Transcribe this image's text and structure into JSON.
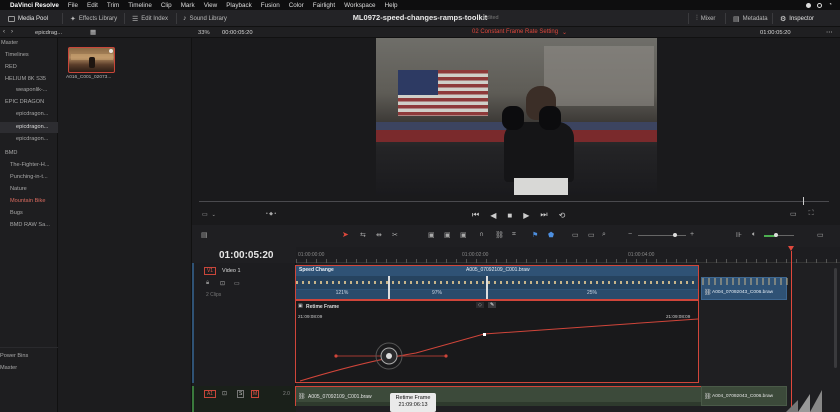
{
  "menubar": {
    "app_name": "DaVinci Resolve",
    "items": [
      "File",
      "Edit",
      "Trim",
      "Timeline",
      "Clip",
      "Mark",
      "View",
      "Playback",
      "Fusion",
      "Color",
      "Fairlight",
      "Workspace",
      "Help"
    ]
  },
  "toolbar": {
    "media_pool": "Media Pool",
    "effects_library": "Effects Library",
    "edit_index": "Edit Index",
    "sound_library": "Sound Library",
    "project_title": "ML0972-speed-changes-ramps-toolkit",
    "edited": "Edited",
    "mixer": "Mixer",
    "metadata": "Metadata",
    "inspector": "Inspector"
  },
  "subbar": {
    "bin_name": "epicdrag...",
    "zoom": "33%",
    "source_timecode": "00:00:05:20",
    "timeline_name": "02 Constant Frame Rate Setting",
    "record_timecode": "01:00:05:20"
  },
  "bins": [
    {
      "label": "Master"
    },
    {
      "label": "Timelines"
    },
    {
      "label": "RED"
    },
    {
      "label": "HELIUM 8K S35"
    },
    {
      "label": "weaponlik-..."
    },
    {
      "label": "EPIC DRAGON"
    },
    {
      "label": "epicdragon..."
    },
    {
      "label": "epicdragon..."
    },
    {
      "label": "epicdragon..."
    },
    {
      "label": "BMD"
    },
    {
      "label": "The-Fighter-H..."
    },
    {
      "label": "Punching-in-t..."
    },
    {
      "label": "Nature"
    },
    {
      "label": "Mountain Bike"
    },
    {
      "label": "Bugs"
    },
    {
      "label": "BMD RAW Sa..."
    }
  ],
  "smart_bins": {
    "title": "Power Bins",
    "master": "Master"
  },
  "media_clip": {
    "label": "A016_C001_02073..."
  },
  "timeline": {
    "timecode": "01:00:05:20",
    "ruler": [
      "01:00:00:00",
      "01:00:02:00",
      "01:00:04:00"
    ],
    "v1_label": "V1",
    "v1_name": "Video 1",
    "v1_clips": "2 Clips",
    "a1_label": "A1",
    "a1_level": "2.0",
    "speed_change_label": "Speed Change",
    "clip1_name": "A005_07092109_C001.braw",
    "clip2_name": "A004_07092043_C006.braw",
    "speeds": [
      "121%",
      "97%",
      "25%"
    ],
    "retime_frame_label": "Retime Frame",
    "curve_start_tc": "21:09:08:09",
    "curve_end_tc": "21:09:08:09",
    "tooltip_title": "Retime Frame",
    "tooltip_tc": "21:09:06:13",
    "audio_clip1": "A005_07092109_C001.braw",
    "audio_clip2": "A004_07092043_C006.braw"
  },
  "colors": {
    "accent_red": "#d0453a",
    "clip_blue": "#2f5275",
    "audio_green": "#3c4a3a"
  }
}
